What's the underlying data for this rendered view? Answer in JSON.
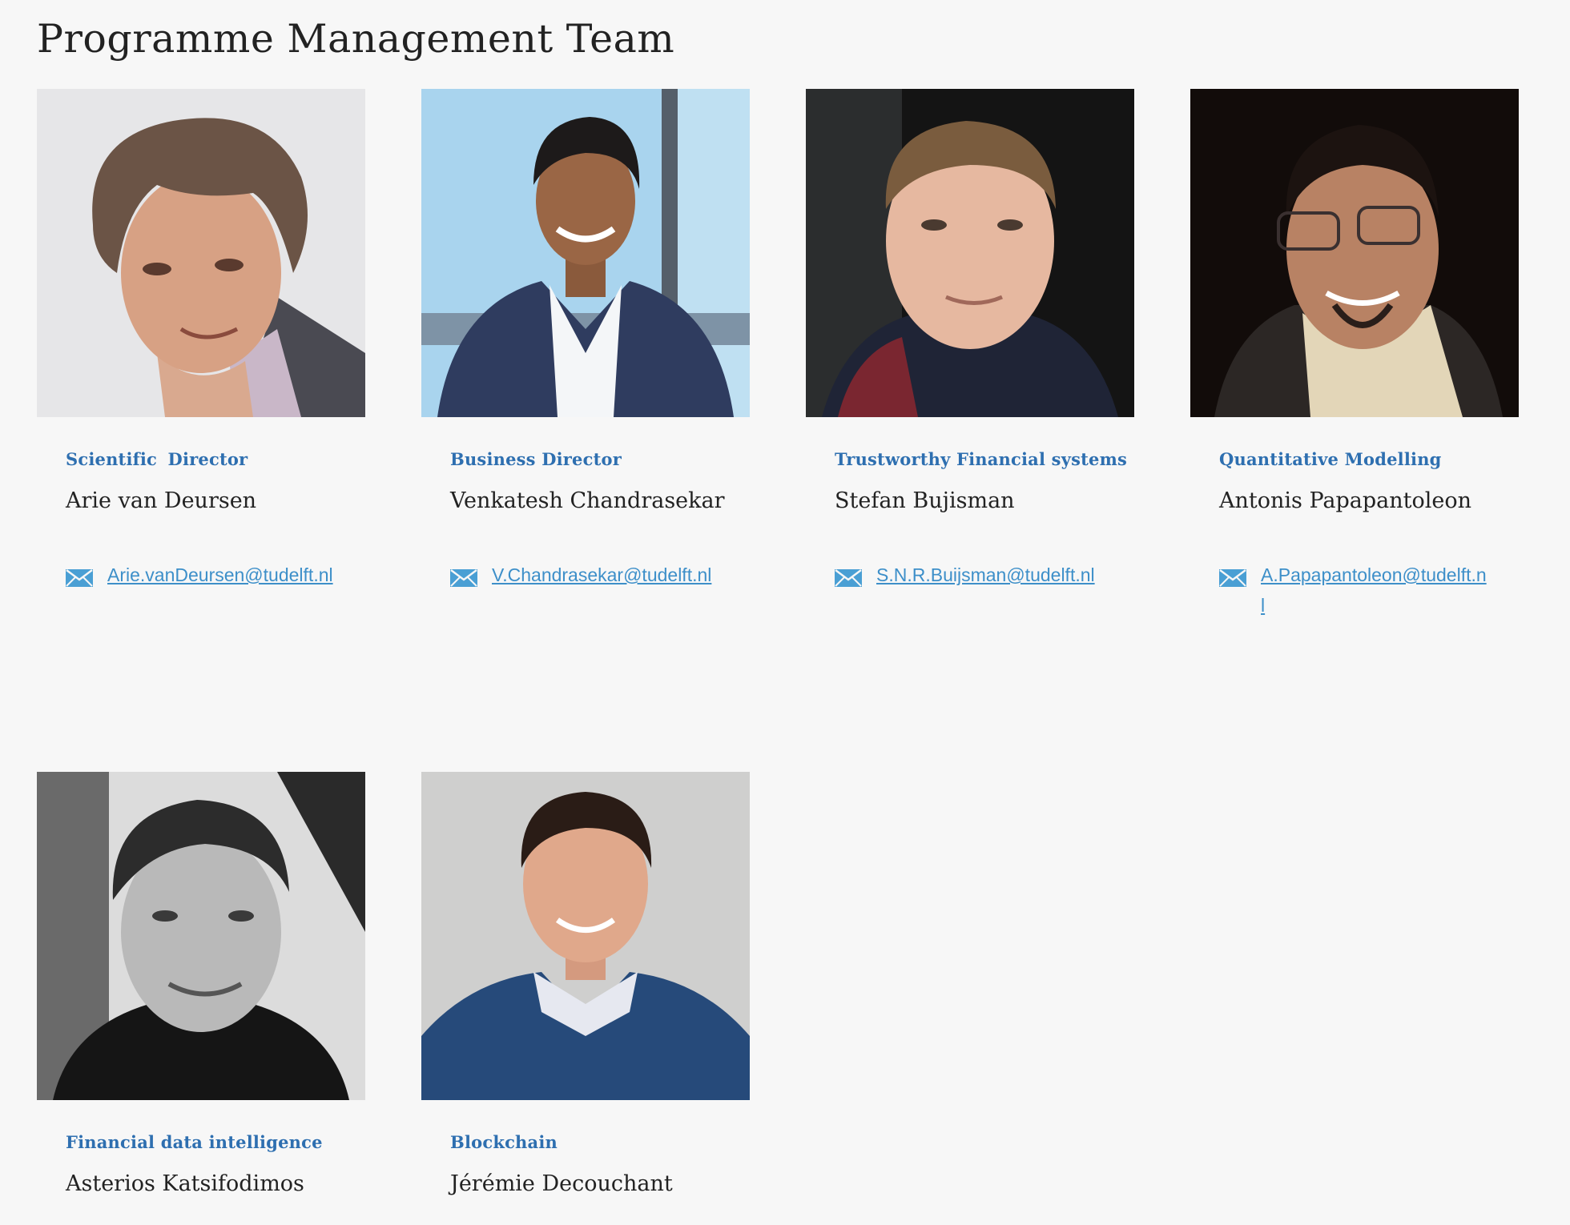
{
  "page": {
    "title": "Programme Management Team"
  },
  "team": [
    {
      "role": "Scientific Director",
      "name": "Arie van Deursen",
      "email": "Arie.vanDeursen@tudelft.nl"
    },
    {
      "role": "Business Director",
      "name": "Venkatesh Chandrasekar",
      "email": "V.Chandrasekar@tudelft.nl"
    },
    {
      "role": "Trustworthy Financial systems",
      "name": "Stefan Bujisman",
      "email": "S.N.R.Buijsman@tudelft.nl"
    },
    {
      "role": "Quantitative Modelling",
      "name": "Antonis Papapantoleon",
      "email": "A.Papapantoleon@tudelft.nl"
    },
    {
      "role": "Financial data intelligence",
      "name": "Asterios Katsifodimos",
      "email": ""
    },
    {
      "role": "Blockchain",
      "name": "Jérémie Decouchant",
      "email": ""
    }
  ],
  "icons": {
    "email": "envelope-icon"
  },
  "colors": {
    "background": "#f7f7f7",
    "role_text": "#2e6fb0",
    "name_text": "#222222",
    "link": "#3d8fc9",
    "icon": "#4a9fd4"
  }
}
